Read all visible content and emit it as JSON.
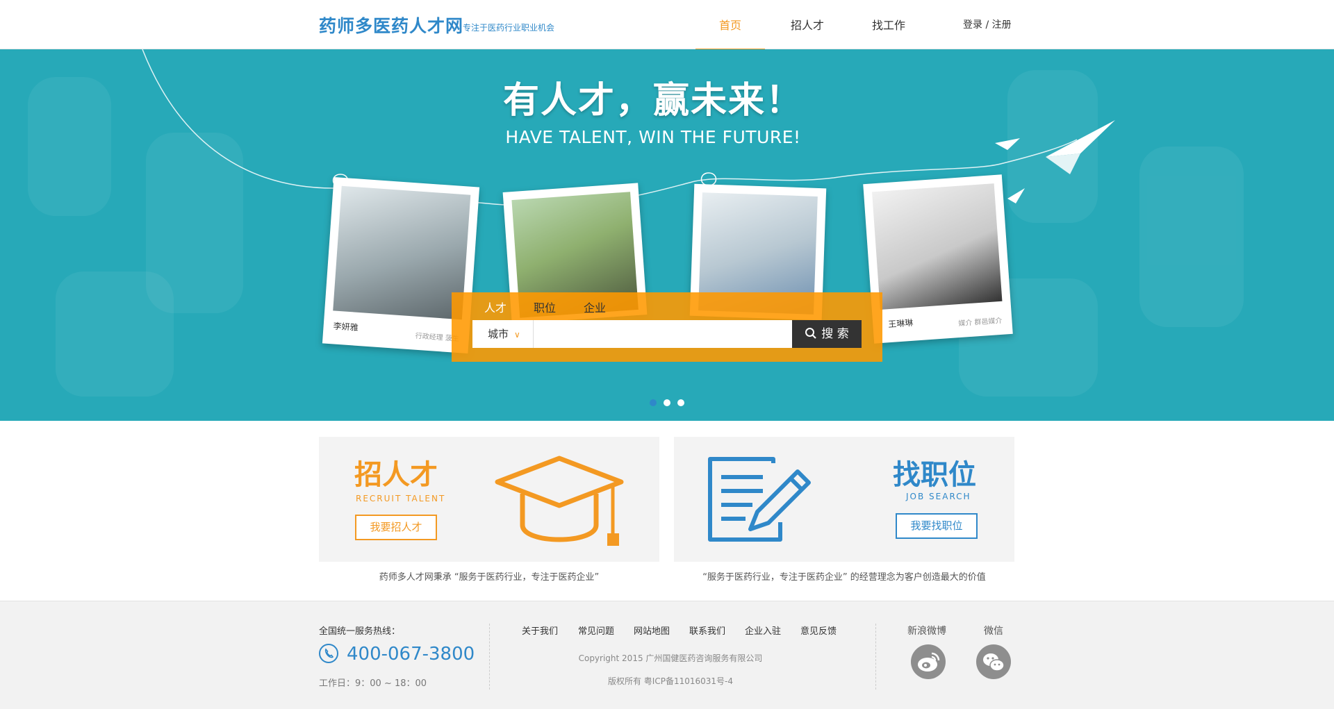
{
  "header": {
    "logo": "药师多医药人才网",
    "slogan": "专注于医药行业职业机会",
    "nav": [
      {
        "label": "首页"
      },
      {
        "label": "招人才"
      },
      {
        "label": "找工作"
      }
    ],
    "login": "登录 / 注册"
  },
  "banner": {
    "title": "有人才，赢未来！",
    "subtitle": "HAVE TALENT, WIN THE FUTURE!",
    "photos": [
      {
        "name": "李妍雅",
        "role": "行政经理  菠生"
      },
      {
        "name": "",
        "role": ""
      },
      {
        "name": "",
        "role": ""
      },
      {
        "name": "王琳琳",
        "role": "媒介  群邑媒介"
      }
    ],
    "carousel_active_index": 0,
    "carousel_count": 3
  },
  "search": {
    "tabs": [
      {
        "label": "人才"
      },
      {
        "label": "职位"
      },
      {
        "label": "企业"
      }
    ],
    "city_label": "城市",
    "input_value": "",
    "button_label": "搜 索"
  },
  "cards": {
    "recruit": {
      "title": "招人才",
      "subtitle": "RECRUIT TALENT",
      "button": "我要招人才",
      "desc": "药师多人才网秉承 “服务于医药行业，专注于医药企业”"
    },
    "job": {
      "title": "找职位",
      "subtitle": "JOB SEARCH",
      "button": "我要找职位",
      "desc": "“服务于医药行业，专注于医药企业” 的经营理念为客户创造最大的价值"
    }
  },
  "footer": {
    "hotline_label": "全国统一服务热线：",
    "phone": "400-067-3800",
    "hours": "工作日：9：00 ~ 18：00",
    "links": [
      "关于我们",
      "常见问题",
      "网站地图",
      "联系我们",
      "企业入驻",
      "意见反馈"
    ],
    "copyright": "Copyright 2015 广州国健医药咨询服务有限公司",
    "icp": "版权所有    粤ICP备11016031号-4",
    "social": [
      {
        "label": "新浪微博",
        "icon": "weibo-icon"
      },
      {
        "label": "微信",
        "icon": "wechat-icon"
      }
    ]
  },
  "colors": {
    "brand_blue": "#2f88c9",
    "accent_orange": "#f39922",
    "banner_teal": "#27a9b8"
  }
}
